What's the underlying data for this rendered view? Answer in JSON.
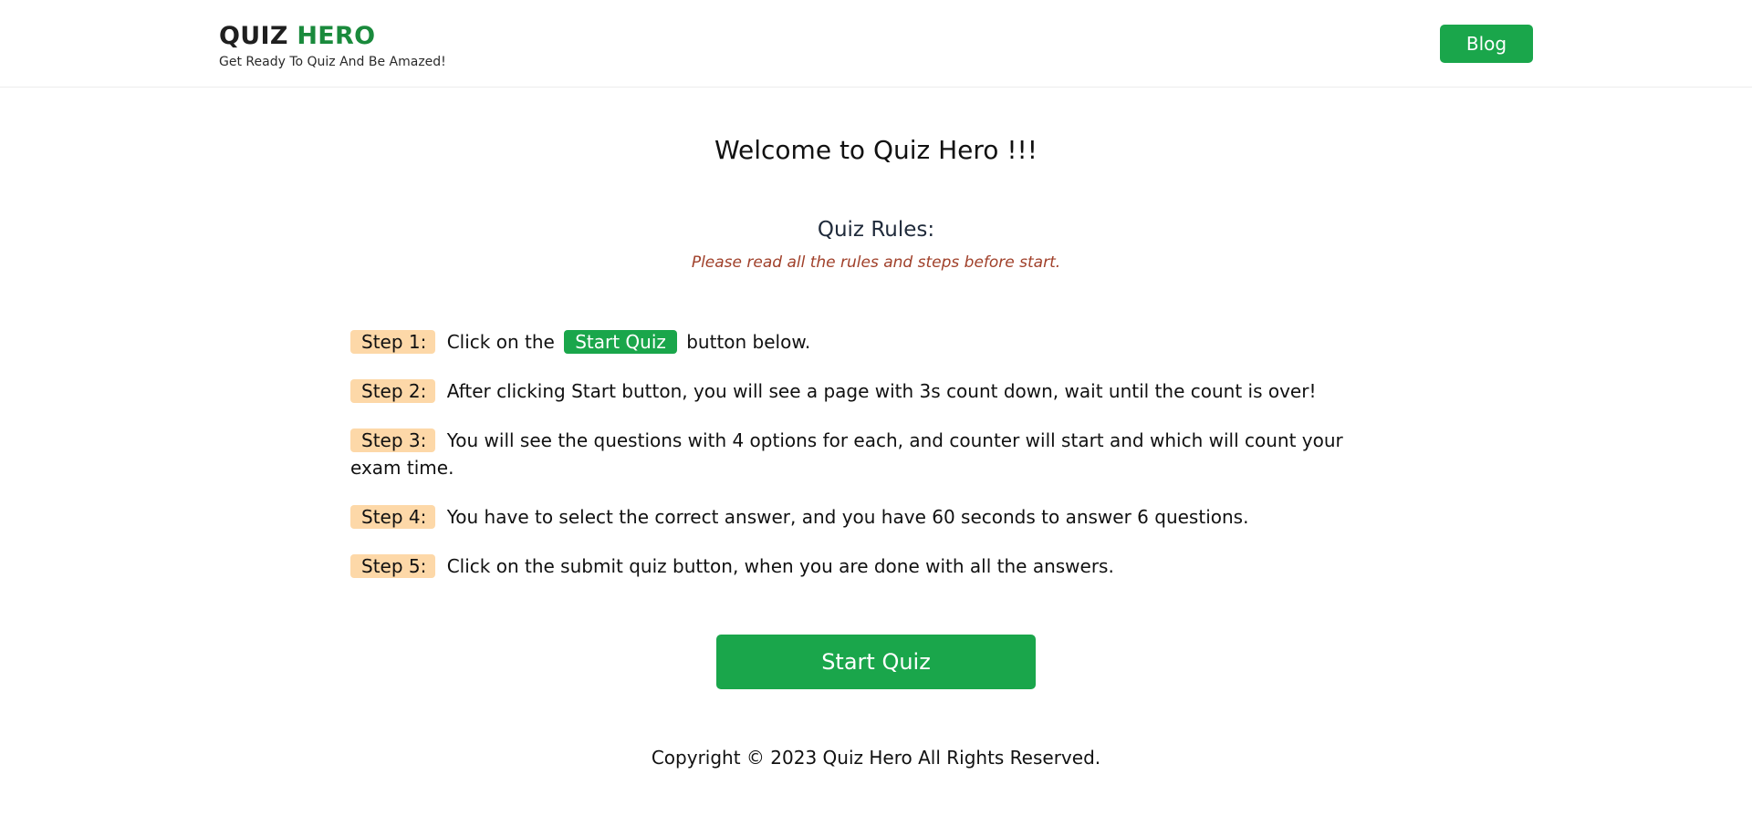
{
  "header": {
    "brand_quiz": "QUIZ",
    "brand_hero": "HERO",
    "tagline": "Get Ready To Quiz And Be Amazed!",
    "blog_label": "Blog"
  },
  "main": {
    "welcome": "Welcome to Quiz Hero !!!",
    "rules_heading": "Quiz Rules:",
    "rules_note": "Please read all the rules and steps before start.",
    "steps": [
      {
        "badge": "Step 1:",
        "text_before": "Click on the",
        "inline_button": "Start Quiz",
        "text_after": "button below."
      },
      {
        "badge": "Step 2:",
        "text": "After clicking Start button, you will see a page with 3s count down, wait until the count is over!"
      },
      {
        "badge": "Step 3:",
        "text": "You will see the questions with 4 options for each, and counter will start and which will count your exam time."
      },
      {
        "badge": "Step 4:",
        "text": "You have to select the correct answer, and you have 60 seconds to answer 6 questions."
      },
      {
        "badge": "Step 5:",
        "text": "Click on the submit quiz button, when you are done with all the answers."
      }
    ],
    "start_button_label": "Start Quiz"
  },
  "footer": {
    "copyright": "Copyright © 2023 Quiz Hero All Rights Reserved."
  },
  "colors": {
    "accent_green": "#1aa64b",
    "brand_green": "#1a8a3c",
    "step_badge_bg": "#fdd8a8",
    "note_text": "#a0402a"
  }
}
